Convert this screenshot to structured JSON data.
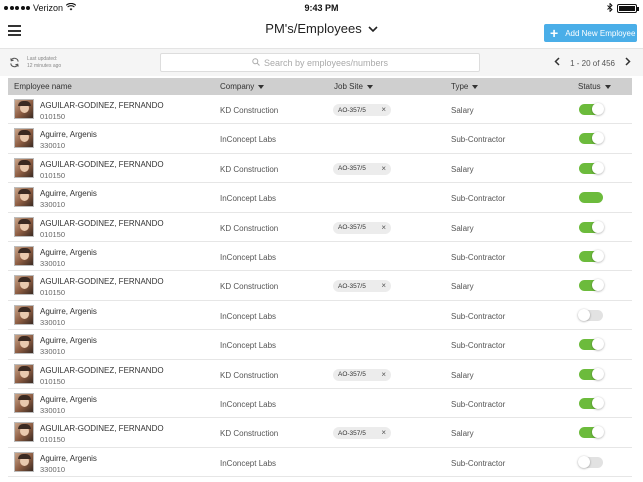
{
  "status_bar": {
    "carrier": "Verizon",
    "time": "9:43 PM"
  },
  "header": {
    "title": "PM's/Employees",
    "add_button": "Add New Employee"
  },
  "toolbar": {
    "updated_line1": "Last updated:",
    "updated_line2": "12 minutes ago",
    "search_placeholder": "Search by employees/numbers",
    "pagination": "1 - 20 of 456"
  },
  "columns": {
    "name": "Employee name",
    "company": "Company",
    "job_site": "Job Site",
    "type": "Type",
    "status": "Status"
  },
  "rows": [
    {
      "name": "AGUILAR-GODINEZ,  FERNANDO",
      "number": "010150",
      "company": "KD Construction",
      "job_site": "AO-357/5",
      "type": "Salary",
      "status": "on"
    },
    {
      "name": "Aguirre, Argenis",
      "number": "330010",
      "company": "InConcept Labs",
      "job_site": "",
      "type": "Sub-Contractor",
      "status": "on"
    },
    {
      "name": "AGUILAR-GODINEZ, FERNANDO",
      "number": "010150",
      "company": "KD Construction",
      "job_site": "AO-357/5",
      "type": "Salary",
      "status": "on"
    },
    {
      "name": "Aguirre, Argenis",
      "number": "330010",
      "company": "InConcept Labs",
      "job_site": "",
      "type": "Sub-Contractor",
      "status": "on-noknob"
    },
    {
      "name": "AGUILAR-GODINEZ,  FERNANDO",
      "number": "010150",
      "company": "KD Construction",
      "job_site": "AO-357/5",
      "type": "Salary",
      "status": "on"
    },
    {
      "name": "Aguirre, Argenis",
      "number": "330010",
      "company": "InConcept Labs",
      "job_site": "",
      "type": "Sub-Contractor",
      "status": "on"
    },
    {
      "name": "AGUILAR-GODINEZ,  FERNANDO",
      "number": "010150",
      "company": "KD Construction",
      "job_site": "AO-357/5",
      "type": "Salary",
      "status": "on"
    },
    {
      "name": "Aguirre, Argenis",
      "number": "330010",
      "company": "InConcept Labs",
      "job_site": "",
      "type": "Sub-Contractor",
      "status": "off"
    },
    {
      "name": "Aguirre, Argenis",
      "number": "330010",
      "company": "InConcept Labs",
      "job_site": "",
      "type": "Sub-Contractor",
      "status": "on"
    },
    {
      "name": "AGUILAR-GODINEZ,  FERNANDO",
      "number": "010150",
      "company": "KD Construction",
      "job_site": "AO-357/5",
      "type": "Salary",
      "status": "on"
    },
    {
      "name": "Aguirre, Argenis",
      "number": "330010",
      "company": "InConcept Labs",
      "job_site": "",
      "type": "Sub-Contractor",
      "status": "on"
    },
    {
      "name": "AGUILAR-GODINEZ,  FERNANDO",
      "number": "010150",
      "company": "KD Construction",
      "job_site": "AO-357/5",
      "type": "Salary",
      "status": "on"
    },
    {
      "name": "Aguirre, Argenis",
      "number": "330010",
      "company": "InConcept Labs",
      "job_site": "",
      "type": "Sub-Contractor",
      "status": "off"
    }
  ],
  "colors": {
    "accent": "#4aaee8",
    "toggle_on": "#6cbb3c",
    "toggle_off": "#e2e2e2",
    "header_bg": "#cfcfcf"
  },
  "icons": {
    "menu": "hamburger-icon",
    "refresh": "refresh-icon",
    "search": "search-icon",
    "prev": "chevron-left-icon",
    "next": "chevron-right-icon"
  }
}
